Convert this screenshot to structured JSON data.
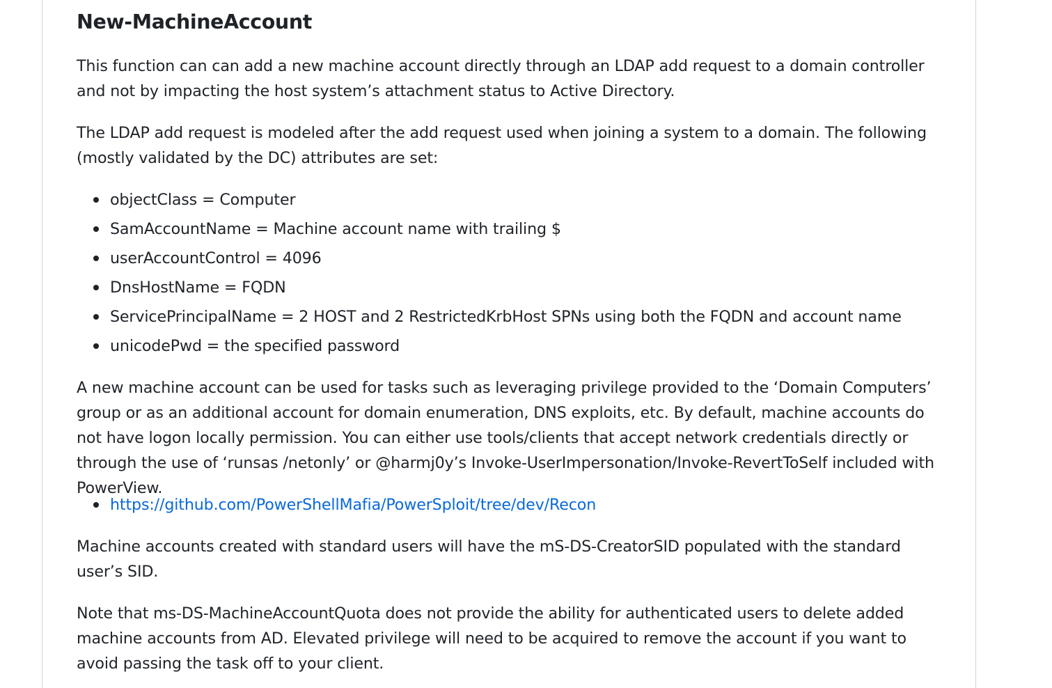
{
  "heading": "New-MachineAccount",
  "paragraphs": {
    "intro": "This function can can add a new machine account directly through an LDAP add request to a domain controller and not by impacting the host system’s attachment status to Active Directory.",
    "ldap": "The LDAP add request is modeled after the add request used when joining a system to a domain. The following (mostly validated by the DC) attributes are set:",
    "usage": "A new machine account can be used for tasks such as leveraging privilege provided to the ‘Domain Computers’ group or as an additional account for domain enumeration, DNS exploits, etc. By default, machine accounts do not have logon locally permission. You can either use tools/clients that accept network credentials directly or through the use of ‘runsas /netonly’ or @harmj0y’s Invoke-UserImpersonation/Invoke-RevertToSelf included with PowerView.",
    "creator_sid": "Machine accounts created with standard users will have the mS-DS-CreatorSID populated with the standard user’s SID.",
    "note": "Note that ms-DS-MachineAccountQuota does not provide the ability for authenticated users to delete added machine accounts from AD. Elevated privilege will need to be acquired to remove the account if you want to avoid passing the task off to your client."
  },
  "attributes": [
    "objectClass = Computer",
    "SamAccountName = Machine account name with trailing $",
    "userAccountControl = 4096",
    "DnsHostName = FQDN",
    "ServicePrincipalName = 2 HOST and 2 RestrictedKrbHost SPNs using both the FQDN and account name",
    "unicodePwd = the specified password"
  ],
  "links": [
    "https://github.com/PowerShellMafia/PowerSploit/tree/dev/Recon"
  ],
  "colors": {
    "text": "#1f2328",
    "link": "#0969da",
    "border": "#d0d7de"
  }
}
